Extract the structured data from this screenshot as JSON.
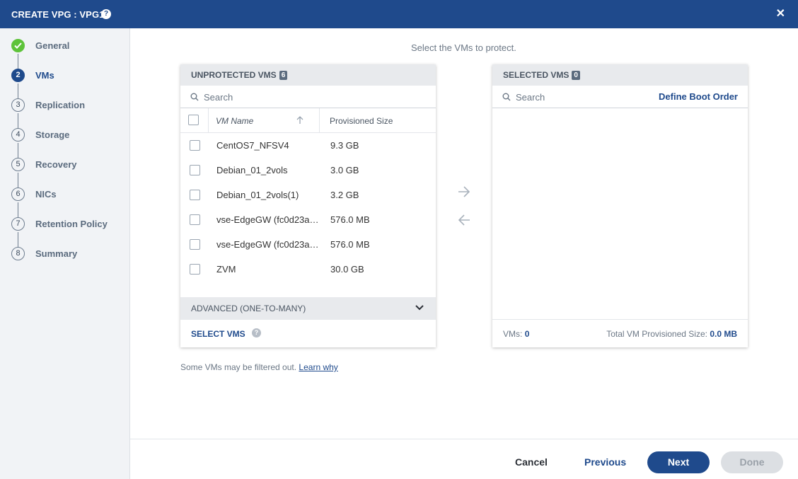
{
  "title": "CREATE VPG : VPG1",
  "steps": [
    {
      "num": "",
      "label": "General",
      "state": "done"
    },
    {
      "num": "2",
      "label": "VMs",
      "state": "active"
    },
    {
      "num": "3",
      "label": "Replication",
      "state": "todo"
    },
    {
      "num": "4",
      "label": "Storage",
      "state": "todo"
    },
    {
      "num": "5",
      "label": "Recovery",
      "state": "todo"
    },
    {
      "num": "6",
      "label": "NICs",
      "state": "todo"
    },
    {
      "num": "7",
      "label": "Retention Policy",
      "state": "todo"
    },
    {
      "num": "8",
      "label": "Summary",
      "state": "todo"
    }
  ],
  "instruction": "Select the VMs to protect.",
  "unprotected": {
    "title": "UNPROTECTED VMS",
    "count": "6",
    "search_placeholder": "Search",
    "col_name": "VM Name",
    "col_size": "Provisioned Size",
    "rows": [
      {
        "name": "CentOS7_NFSV4",
        "size": "9.3 GB"
      },
      {
        "name": "Debian_01_2vols",
        "size": "3.0 GB"
      },
      {
        "name": "Debian_01_2vols(1)",
        "size": "3.2 GB"
      },
      {
        "name": "vse-EdgeGW (fc0d23a…",
        "size": "576.0 MB"
      },
      {
        "name": "vse-EdgeGW (fc0d23a…",
        "size": "576.0 MB"
      },
      {
        "name": "ZVM",
        "size": "30.0 GB"
      }
    ],
    "advanced_label": "ADVANCED (ONE-TO-MANY)",
    "select_vms_label": "SELECT VMS"
  },
  "selected": {
    "title": "SELECTED VMS",
    "count": "0",
    "search_placeholder": "Search",
    "boot_order_label": "Define Boot Order",
    "vms_label": "VMs:",
    "vms_count": "0",
    "total_label": "Total VM Provisioned Size:",
    "total_value": "0.0 MB"
  },
  "filtered_note": "Some VMs may be filtered out.",
  "learn_why": "Learn why",
  "buttons": {
    "cancel": "Cancel",
    "previous": "Previous",
    "next": "Next",
    "done": "Done"
  },
  "colors": {
    "brand": "#1f4a8c",
    "success": "#5ec33a",
    "disabled": "#dcdfe3"
  },
  "icons": {
    "help": "question-circle-icon",
    "close": "close-icon",
    "search": "search-icon",
    "sort": "arrow-up-icon",
    "move_right": "arrow-right-icon",
    "move_left": "arrow-left-icon",
    "expand": "chevron-down-icon",
    "step_done": "checkmark-icon"
  }
}
